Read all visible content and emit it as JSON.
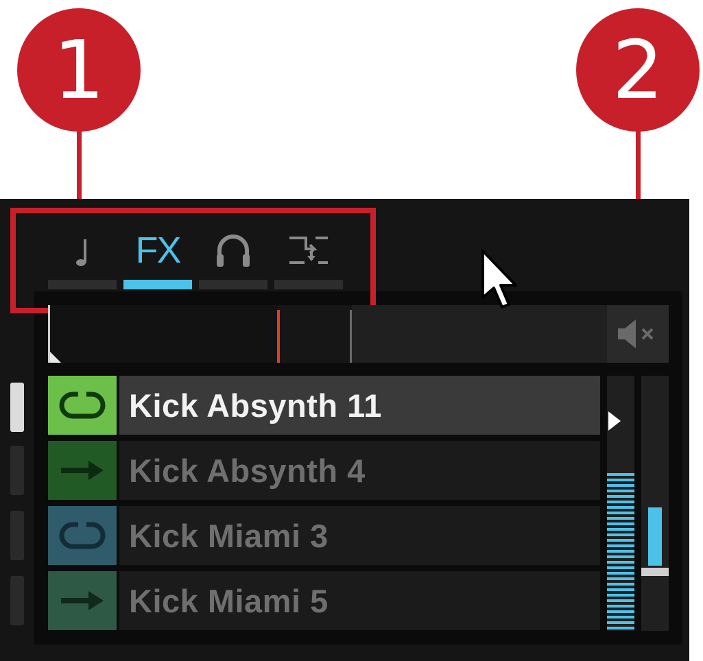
{
  "callouts": [
    {
      "number": "1"
    },
    {
      "number": "2"
    }
  ],
  "tabs": [
    {
      "id": "note",
      "icon": "note-icon",
      "active": false
    },
    {
      "id": "fx",
      "label": "FX",
      "icon": "fx-label",
      "active": true
    },
    {
      "id": "cue",
      "icon": "headphones-icon",
      "active": false
    },
    {
      "id": "routing",
      "icon": "routing-icon",
      "active": false
    }
  ],
  "mute_button": {
    "icon": "speaker-mute-icon"
  },
  "slots": [
    {
      "name": "Kick Absynth 11",
      "type": "loop",
      "icon": "loop-icon",
      "color": "#6cc04a",
      "icon_color": "#0f3a0c",
      "active": true
    },
    {
      "name": "Kick Absynth 4",
      "type": "one-shot",
      "icon": "arrow-right-icon",
      "color": "#225a26",
      "icon_color": "#0c2a0f",
      "active": false
    },
    {
      "name": "Kick Miami 3",
      "type": "loop",
      "icon": "loop-icon",
      "color": "#2f5b6b",
      "icon_color": "#122d38",
      "active": false
    },
    {
      "name": "Kick Miami 5",
      "type": "one-shot",
      "icon": "arrow-right-icon",
      "color": "#2e5a45",
      "icon_color": "#10291d",
      "active": false
    }
  ],
  "colors": {
    "accent": "#4cc2ea",
    "callout": "#c8202a",
    "playhead": "#e0401f"
  },
  "fader": {
    "level": 0.45
  }
}
